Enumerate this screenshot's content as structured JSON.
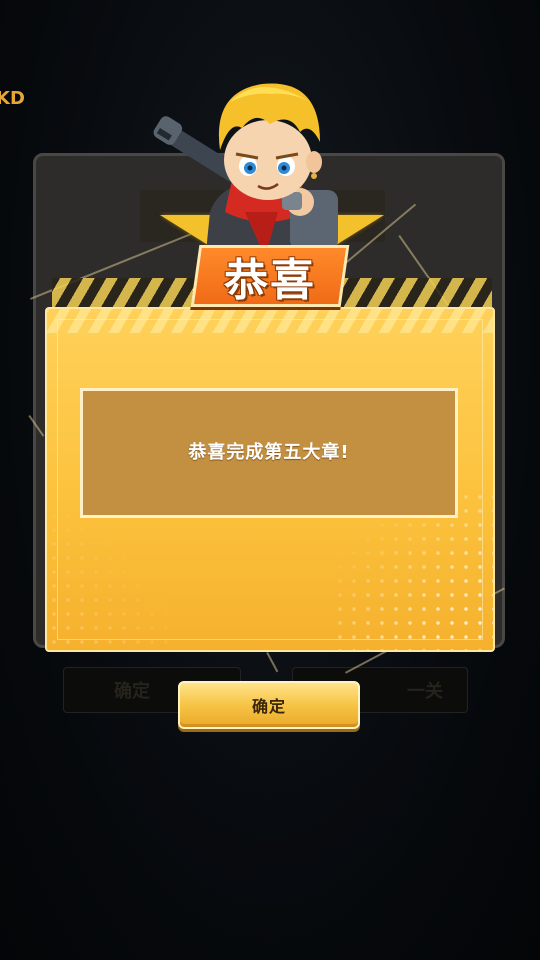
{
  "corner_text": "KD",
  "background_dialog": {
    "title_fragment": "",
    "left_button_label": "确定",
    "right_button_label": "一关"
  },
  "dialog": {
    "title": "恭喜",
    "message": "恭喜完成第五大章!",
    "confirm_label": "确定"
  },
  "character": {
    "icon": "hero-character-with-rifle"
  },
  "colors": {
    "dialog_yellow": "#fcc23d",
    "message_bg": "#c39042",
    "title_orange": "#f06b17",
    "button_gold": "#f7c446"
  }
}
